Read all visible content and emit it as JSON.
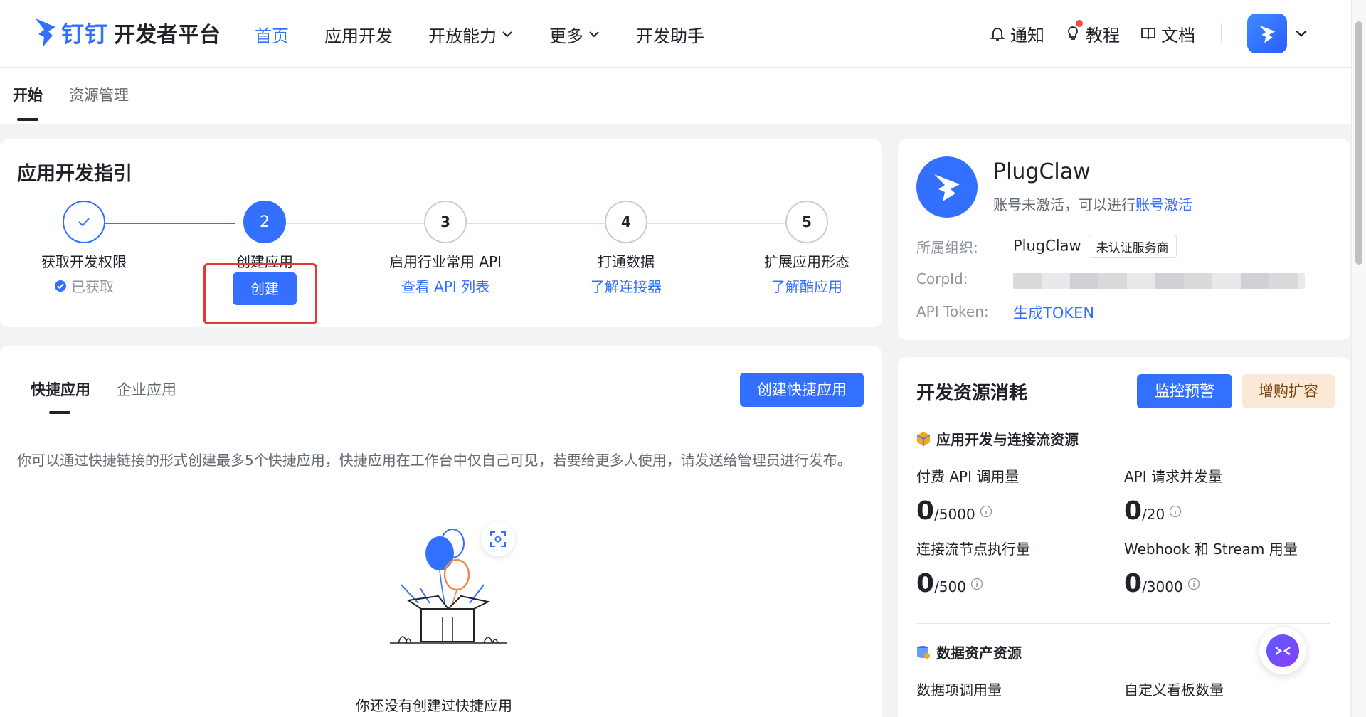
{
  "header": {
    "logo_text": "钉钉",
    "logo_sub": "开发者平台",
    "nav": [
      {
        "label": "首页",
        "active": true,
        "dropdown": false
      },
      {
        "label": "应用开发",
        "active": false,
        "dropdown": false
      },
      {
        "label": "开放能力",
        "active": false,
        "dropdown": true
      },
      {
        "label": "更多",
        "active": false,
        "dropdown": true
      },
      {
        "label": "开发助手",
        "active": false,
        "dropdown": false
      }
    ],
    "right": {
      "notify": "通知",
      "tutorial": "教程",
      "docs": "文档"
    },
    "accent": "#3370ff"
  },
  "subtabs": {
    "start": "开始",
    "resources": "资源管理"
  },
  "guide": {
    "title": "应用开发指引",
    "steps": [
      {
        "num": "1",
        "label": "获取开发权限",
        "action": "已获取",
        "state": "done"
      },
      {
        "num": "2",
        "label": "创建应用",
        "action": "创建",
        "state": "current"
      },
      {
        "num": "3",
        "label": "启用行业常用 API",
        "action": "查看 API 列表",
        "state": "todo"
      },
      {
        "num": "4",
        "label": "打通数据",
        "action": "了解连接器",
        "state": "todo"
      },
      {
        "num": "5",
        "label": "扩展应用形态",
        "action": "了解酷应用",
        "state": "todo"
      }
    ]
  },
  "quick": {
    "tab_quick": "快捷应用",
    "tab_enterprise": "企业应用",
    "create_button": "创建快捷应用",
    "description": "你可以通过快捷链接的形式创建最多5个快捷应用，快捷应用在工作台中仅自己可见，若要给更多人使用，请发送给管理员进行发布。",
    "empty_text": "你还没有创建过快捷应用"
  },
  "profile": {
    "name": "PlugClaw",
    "status_prefix": "账号未激活，可以进行",
    "status_link": "账号激活",
    "org_label": "所属组织:",
    "org_value": "PlugClaw",
    "org_badge": "未认证服务商",
    "corpid_label": "CorpId:",
    "token_label": "API Token:",
    "token_link": "生成TOKEN"
  },
  "resources": {
    "title": "开发资源消耗",
    "monitor_button": "监控预警",
    "expand_button": "增购扩容",
    "section1": "应用开发与连接流资源",
    "section2": "数据资产资源",
    "metrics": [
      {
        "label": "付费 API 调用量",
        "used": "0",
        "total": "/5000"
      },
      {
        "label": "API 请求并发量",
        "used": "0",
        "total": "/20"
      },
      {
        "label": "连接流节点执行量",
        "used": "0",
        "total": "/500"
      },
      {
        "label": "Webhook 和 Stream 用量",
        "used": "0",
        "total": "/3000"
      }
    ],
    "section2_metrics": [
      {
        "label": "数据项调用量"
      },
      {
        "label": "自定义看板数量"
      }
    ]
  }
}
